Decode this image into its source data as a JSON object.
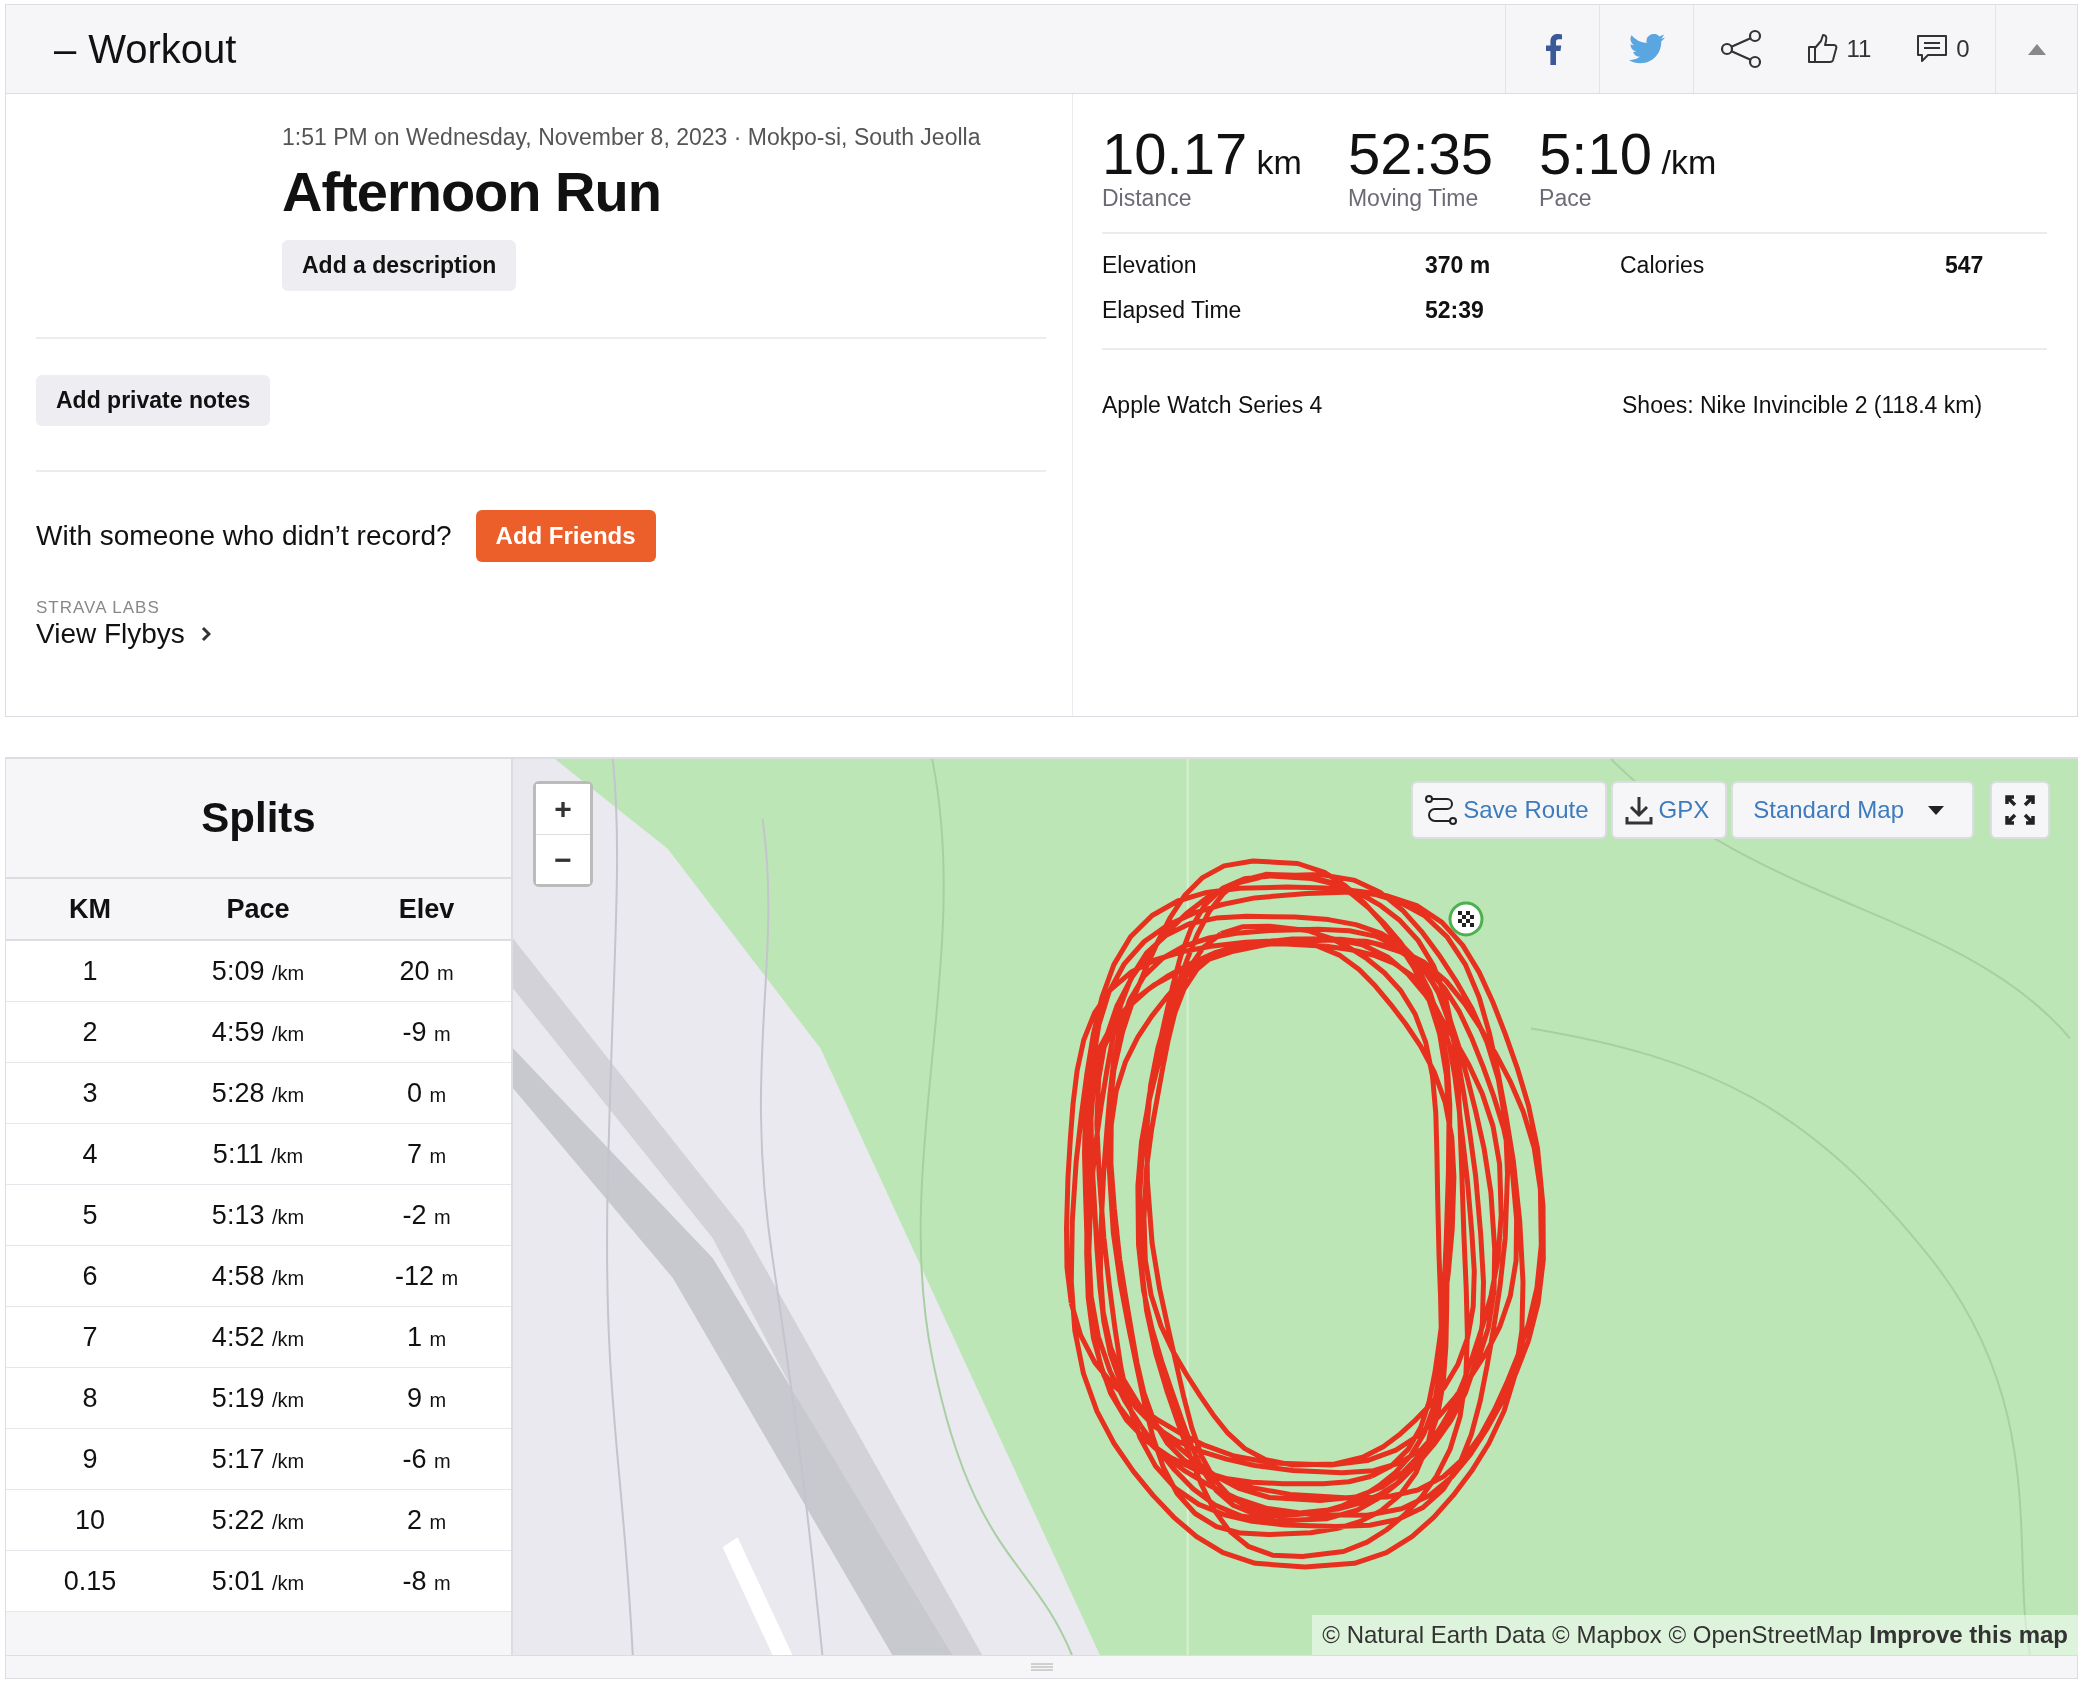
{
  "header": {
    "collapse": "–",
    "title": "Workout",
    "kudos_count": "11",
    "comment_count": "0"
  },
  "activity": {
    "meta": "1:51 PM on Wednesday, November 8, 2023 · Mokpo-si, South Jeolla",
    "title": "Afternoon Run",
    "description_button": "Add a description",
    "notes_button": "Add private notes",
    "friends_prompt": "With someone who didn’t record?",
    "friends_button": "Add Friends",
    "labs_label": "STRAVA LABS",
    "flybys_link": "View Flybys"
  },
  "stats": {
    "primary": [
      {
        "value": "10.17",
        "unit": "km",
        "label": "Distance"
      },
      {
        "value": "52:35",
        "label": "Moving Time"
      },
      {
        "value": "5:10",
        "unit": "/km",
        "label": "Pace"
      }
    ],
    "secondary": [
      {
        "label": "Elevation",
        "value": "370 m"
      },
      {
        "label": "Calories",
        "value": "547"
      },
      {
        "label": "Elapsed Time",
        "value": "52:39"
      }
    ],
    "device": "Apple Watch Series 4",
    "gear": "Shoes: Nike Invincible 2 (118.4 km)"
  },
  "splits": {
    "title": "Splits",
    "columns": [
      "KM",
      "Pace",
      "Elev"
    ],
    "rows": [
      {
        "km": "1",
        "pace": "5:09",
        "pace_unit": "/km",
        "elev": "20",
        "elev_unit": "m"
      },
      {
        "km": "2",
        "pace": "4:59",
        "pace_unit": "/km",
        "elev": "-9",
        "elev_unit": "m"
      },
      {
        "km": "3",
        "pace": "5:28",
        "pace_unit": "/km",
        "elev": "0",
        "elev_unit": "m"
      },
      {
        "km": "4",
        "pace": "5:11",
        "pace_unit": "/km",
        "elev": "7",
        "elev_unit": "m"
      },
      {
        "km": "5",
        "pace": "5:13",
        "pace_unit": "/km",
        "elev": "-2",
        "elev_unit": "m"
      },
      {
        "km": "6",
        "pace": "4:58",
        "pace_unit": "/km",
        "elev": "-12",
        "elev_unit": "m"
      },
      {
        "km": "7",
        "pace": "4:52",
        "pace_unit": "/km",
        "elev": "1",
        "elev_unit": "m"
      },
      {
        "km": "8",
        "pace": "5:19",
        "pace_unit": "/km",
        "elev": "9",
        "elev_unit": "m"
      },
      {
        "km": "9",
        "pace": "5:17",
        "pace_unit": "/km",
        "elev": "-6",
        "elev_unit": "m"
      },
      {
        "km": "10",
        "pace": "5:22",
        "pace_unit": "/km",
        "elev": "2",
        "elev_unit": "m"
      },
      {
        "km": "0.15",
        "pace": "5:01",
        "pace_unit": "/km",
        "elev": "-8",
        "elev_unit": "m"
      }
    ]
  },
  "map": {
    "kind": "picture",
    "zoom_in": "+",
    "zoom_out": "−",
    "save_route": "Save Route",
    "gpx": "GPX",
    "map_type": "Standard Map",
    "attribution": "© Natural Earth Data © Mapbox © OpenStreetMap",
    "improve_link": "Improve this map"
  }
}
